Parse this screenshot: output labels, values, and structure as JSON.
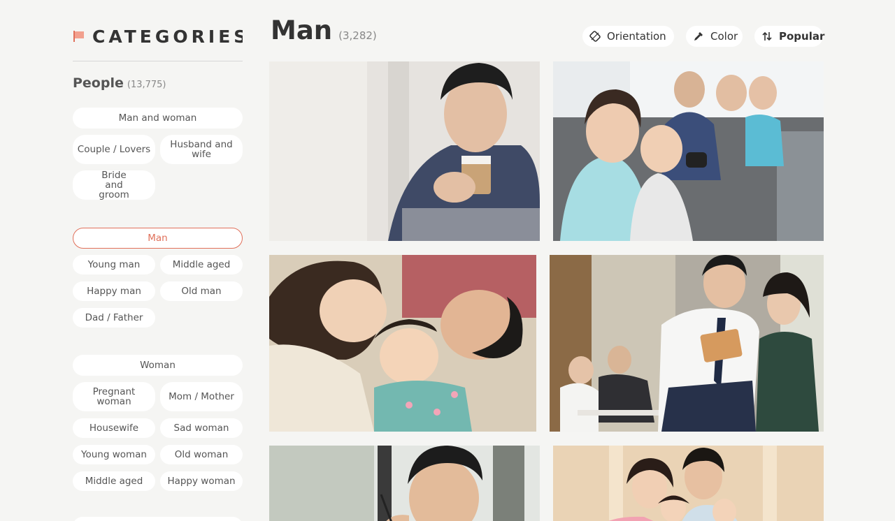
{
  "sidebar": {
    "title": "CATEGORIES",
    "section": {
      "title": "People",
      "count": "(13,775)"
    },
    "group1": [
      "Man and woman",
      "Couple / Lovers",
      "Husband and wife",
      "Bride and groom"
    ],
    "group2": [
      "Man",
      "Young man",
      "Middle aged",
      "Happy man",
      "Old man",
      "Dad / Father"
    ],
    "group3": [
      "Woman",
      "Pregnant woman",
      "Mom / Mother",
      "Housewife",
      "Sad woman",
      "Young woman",
      "Old woman",
      "Middle aged",
      "Happy woman"
    ]
  },
  "main": {
    "title": "Man",
    "count": "(3,282)"
  },
  "toolbar": {
    "orientation": "Orientation",
    "color": "Color",
    "sort": "Popular"
  },
  "colors": {
    "accent": "#e0705a",
    "background": "#f5f5f3"
  }
}
